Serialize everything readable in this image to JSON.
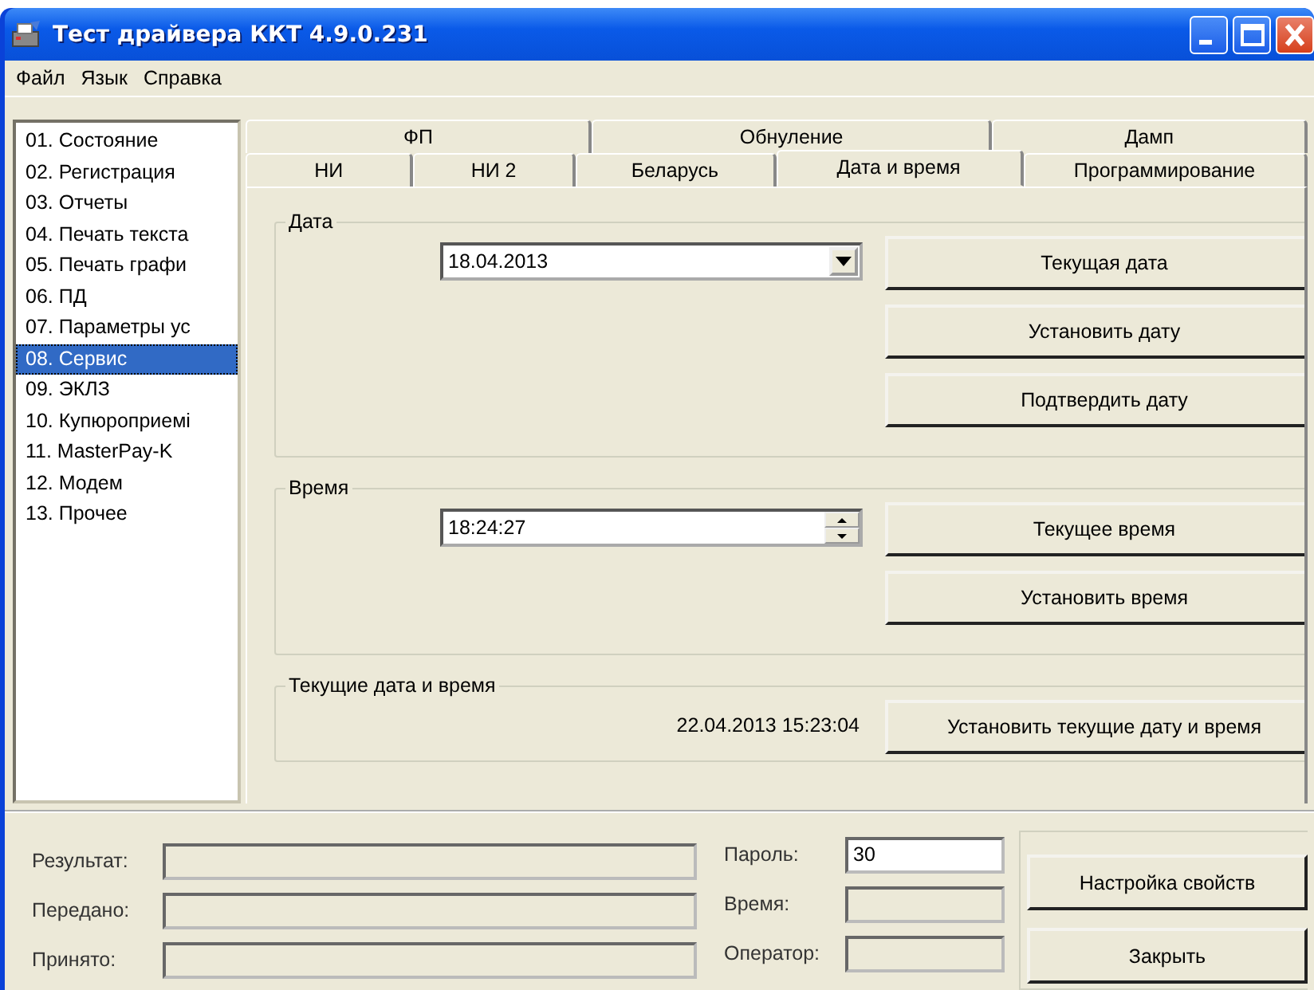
{
  "window": {
    "title": "Тест драйвера ККТ 4.9.0.231"
  },
  "menu": [
    "Файл",
    "Язык",
    "Справка"
  ],
  "sidebar": {
    "items": [
      {
        "label": "01. Состояние",
        "selected": false
      },
      {
        "label": "02. Регистрация",
        "selected": false
      },
      {
        "label": "03. Отчеты",
        "selected": false
      },
      {
        "label": "04. Печать текста",
        "selected": false
      },
      {
        "label": "05. Печать графи",
        "selected": false
      },
      {
        "label": "06. ПД",
        "selected": false
      },
      {
        "label": "07. Параметры ус",
        "selected": false
      },
      {
        "label": "08. Сервис",
        "selected": true
      },
      {
        "label": "09. ЭКЛЗ",
        "selected": false
      },
      {
        "label": "10. Купюроприемі",
        "selected": false
      },
      {
        "label": "11. MasterPay-K",
        "selected": false
      },
      {
        "label": "12. Модем",
        "selected": false
      },
      {
        "label": "13. Прочее",
        "selected": false
      }
    ]
  },
  "tabs": [
    [
      {
        "label": "ФП",
        "selected": false
      },
      {
        "label": "Обнуление",
        "selected": false
      },
      {
        "label": "Дамп",
        "selected": false
      }
    ],
    [
      {
        "label": "НИ",
        "selected": false
      },
      {
        "label": "НИ 2",
        "selected": false
      },
      {
        "label": "Беларусь",
        "selected": false
      },
      {
        "label": "Дата и время",
        "selected": true
      },
      {
        "label": "Программирование",
        "selected": false
      }
    ]
  ],
  "groups": [
    {
      "title": "Дата",
      "field": {
        "kind": "dropdown",
        "value": "18.04.2013"
      },
      "buttons": [
        "Текущая дата",
        "Установить дату",
        "Подтвердить дату"
      ]
    },
    {
      "title": "Время",
      "field": {
        "kind": "spinner",
        "value": "18:24:27"
      },
      "buttons": [
        "Текущее время",
        "Установить время"
      ]
    },
    {
      "title": "Текущие дата и время",
      "field": {
        "kind": "text",
        "value": "22.04.2013  15:23:04"
      },
      "buttons": [
        "Установить текущие дату и время"
      ]
    }
  ],
  "status": {
    "left": [
      {
        "label": "Результат:"
      },
      {
        "label": "Передано:"
      },
      {
        "label": "Принято:"
      }
    ],
    "right": [
      {
        "label": "Пароль:",
        "value": "30",
        "enabled": true
      },
      {
        "label": "Время:",
        "enabled": false
      },
      {
        "label": "Оператор:",
        "enabled": false
      }
    ],
    "buttons": [
      "Настройка свойств",
      "Закрыть"
    ]
  }
}
